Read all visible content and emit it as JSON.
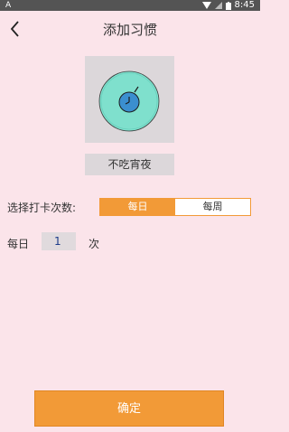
{
  "status_bar": {
    "time": "8:45",
    "left_icon": "A"
  },
  "header": {
    "title": "添加习惯",
    "back_icon": "chevron-left-icon"
  },
  "habit": {
    "icon": "clock-icon",
    "name": "不吃宵夜"
  },
  "frequency": {
    "label": "选择打卡次数:",
    "options": [
      "每日",
      "每周"
    ],
    "selected": "每日"
  },
  "count": {
    "prefix": "每日",
    "value": "1",
    "unit": "次"
  },
  "confirm_label": "确定",
  "colors": {
    "accent": "#f29a37",
    "background": "#fbe4ea",
    "icon_teal": "#7fe0cd",
    "icon_blue": "#3b8fcf"
  }
}
